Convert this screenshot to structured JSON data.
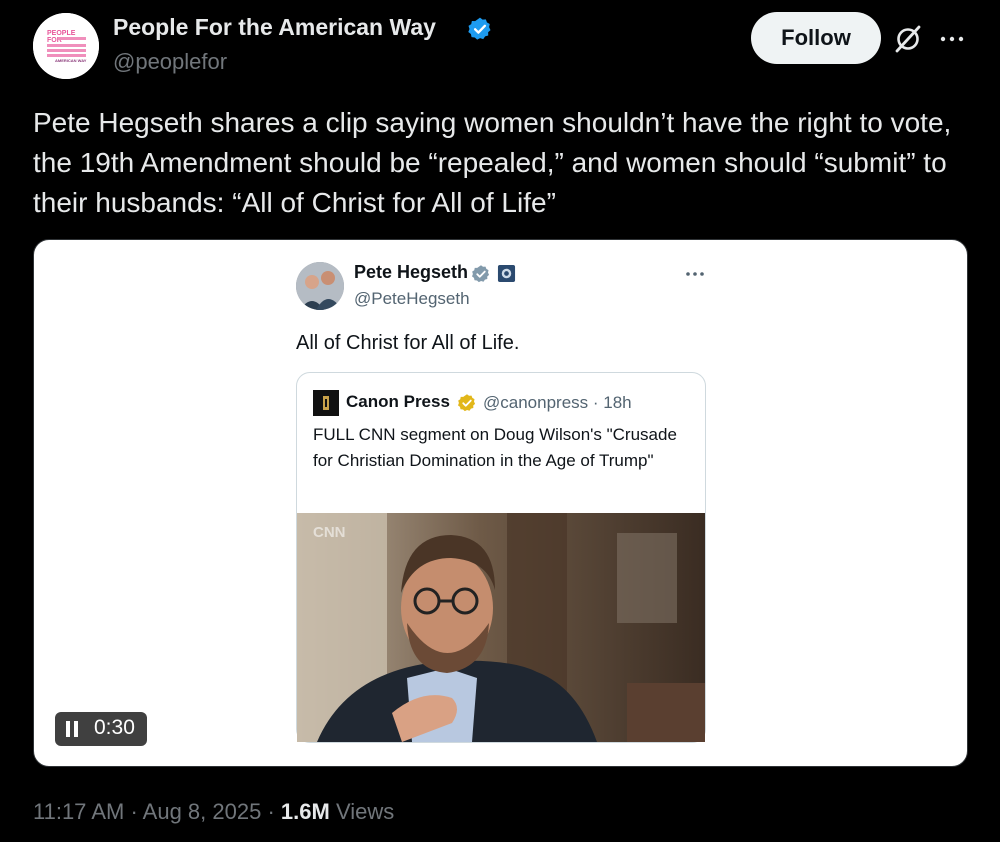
{
  "author": {
    "display_name": "People For the American Way",
    "handle": "@peoplefor",
    "avatar_text": {
      "line1": "PEOPLE",
      "line2": "FOR",
      "line3": "AMERICAN WAY"
    }
  },
  "actions": {
    "follow_label": "Follow",
    "grok_icon": "grok-icon",
    "more_icon": "more-horizontal-icon"
  },
  "post": {
    "text": "Pete Hegseth shares a clip saying women shouldn’t have the right to vote, the 19th Amendment should be “repealed,” and women should “submit” to their husbands: “All of Christ for All of Life”"
  },
  "embedded": {
    "author_name": "Pete Hegseth",
    "author_handle": "@PeteHegseth",
    "text": "All of Christ for All of Life.",
    "quote": {
      "author_name": "Canon Press",
      "handle_time": "@canonpress · 18h",
      "text": "FULL CNN segment on Doug Wilson's \"Crusade for Christian Domination in the Age of Trump\"",
      "video_watermark": "CNN"
    }
  },
  "video": {
    "duration": "0:30",
    "state_icon": "pause-icon"
  },
  "meta": {
    "time": "11:17 AM",
    "separator1": " · ",
    "date": "Aug 8, 2025",
    "separator2": " · ",
    "views_count": "1.6M",
    "views_label": " Views"
  },
  "colors": {
    "background": "#000000",
    "verified_blue": "#1d9bf0",
    "verified_gold": "#e2b719",
    "text_primary": "#e7e9ea",
    "text_secondary": "#71767b"
  }
}
